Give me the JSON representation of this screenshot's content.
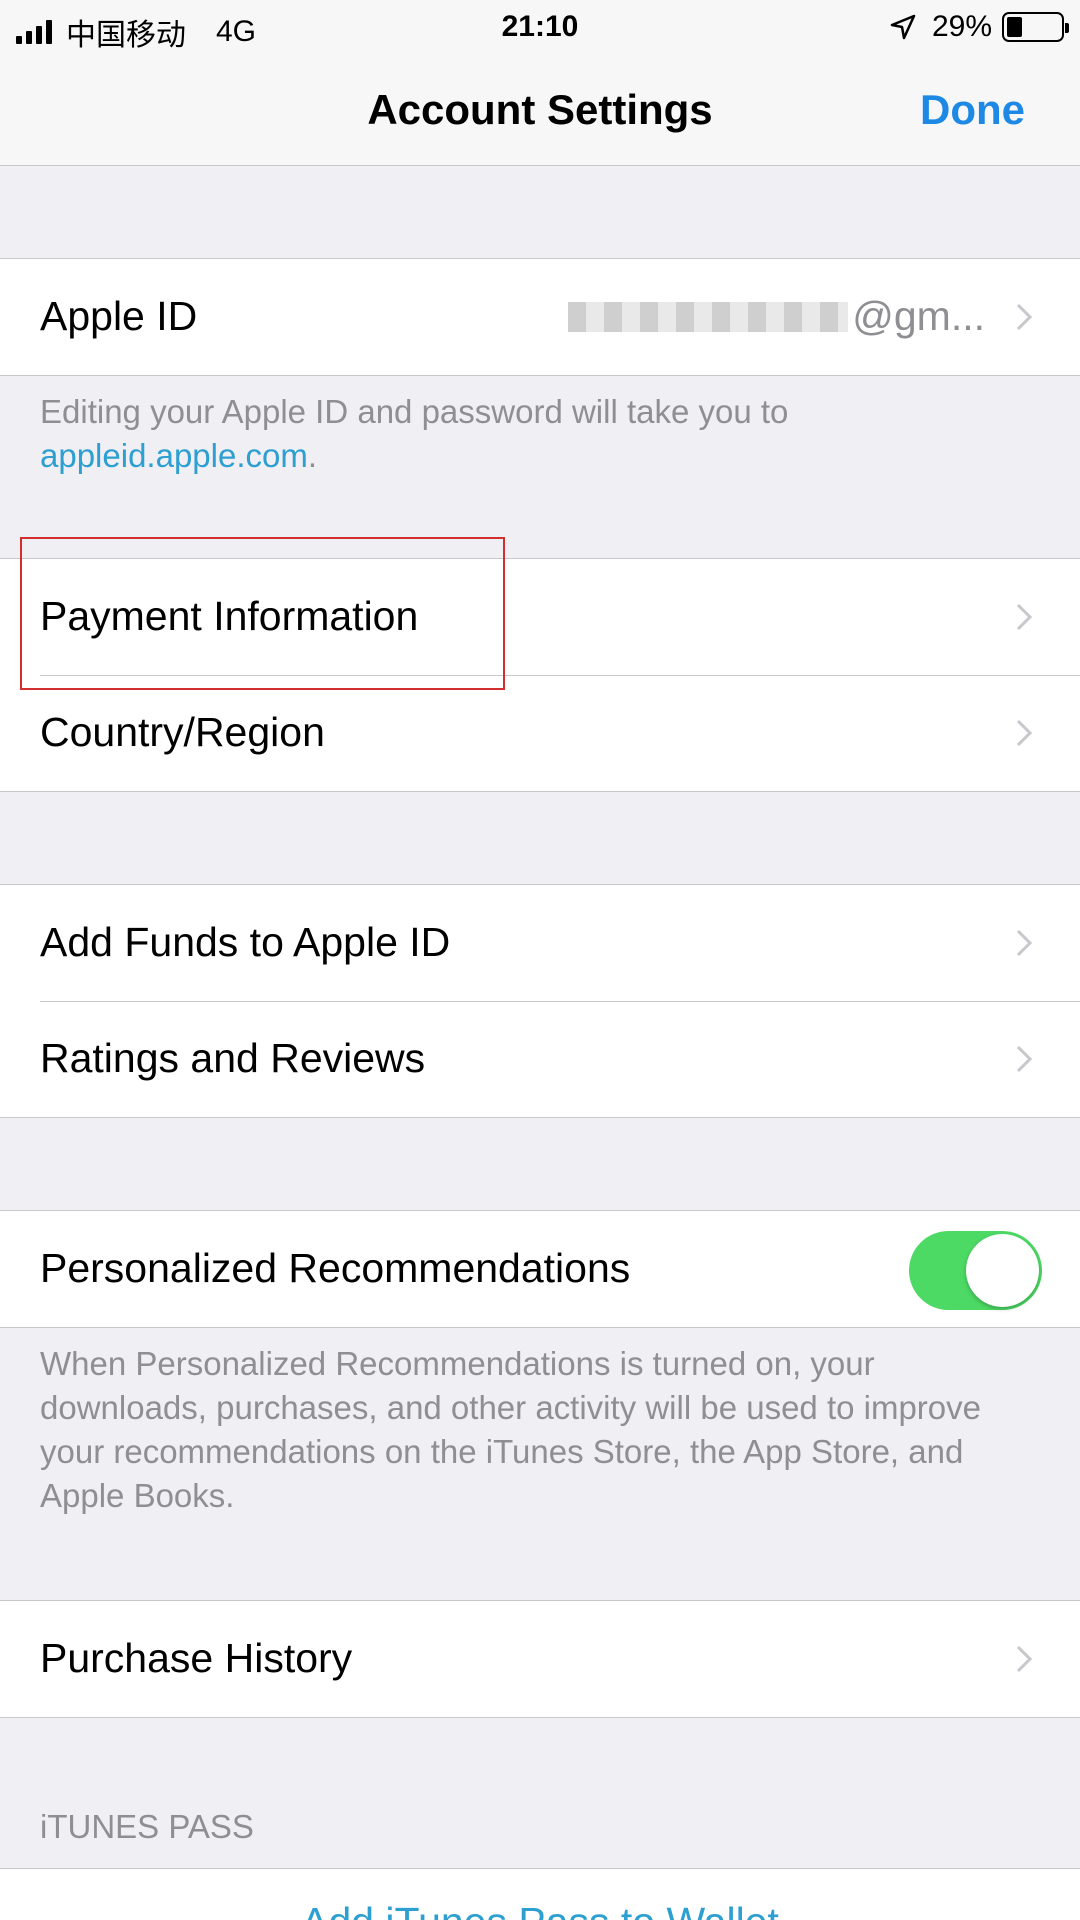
{
  "status_bar": {
    "carrier": "中国移动",
    "network": "4G",
    "time": "21:10",
    "battery": "29%",
    "battery_level": 0.29
  },
  "nav": {
    "title": "Account Settings",
    "done_label": "Done"
  },
  "apple_id": {
    "label": "Apple ID",
    "value_suffix": "@gm..."
  },
  "apple_id_footer": {
    "text": "Editing your Apple ID and password will take you to",
    "link": "appleid.apple.com",
    "period": "."
  },
  "payment_group": {
    "payment_label": "Payment Information",
    "country_label": "Country/Region"
  },
  "funds_group": {
    "add_funds_label": "Add Funds to Apple ID",
    "ratings_label": "Ratings and Reviews"
  },
  "recommendations": {
    "label": "Personalized Recommendations",
    "enabled": true,
    "footer": "When Personalized Recommendations is turned on, your downloads, purchases, and other activity will be used to improve your recommendations on the iTunes Store, the App Store, and Apple Books."
  },
  "purchase_history": {
    "label": "Purchase History"
  },
  "itunes_pass": {
    "header": "iTUNES PASS",
    "add_label": "Add iTunes Pass to Wallet"
  },
  "colors": {
    "accent": "#1e88e5",
    "link": "#2d9fd0",
    "toggle_on": "#4cd964",
    "highlight": "#d32f2f"
  }
}
